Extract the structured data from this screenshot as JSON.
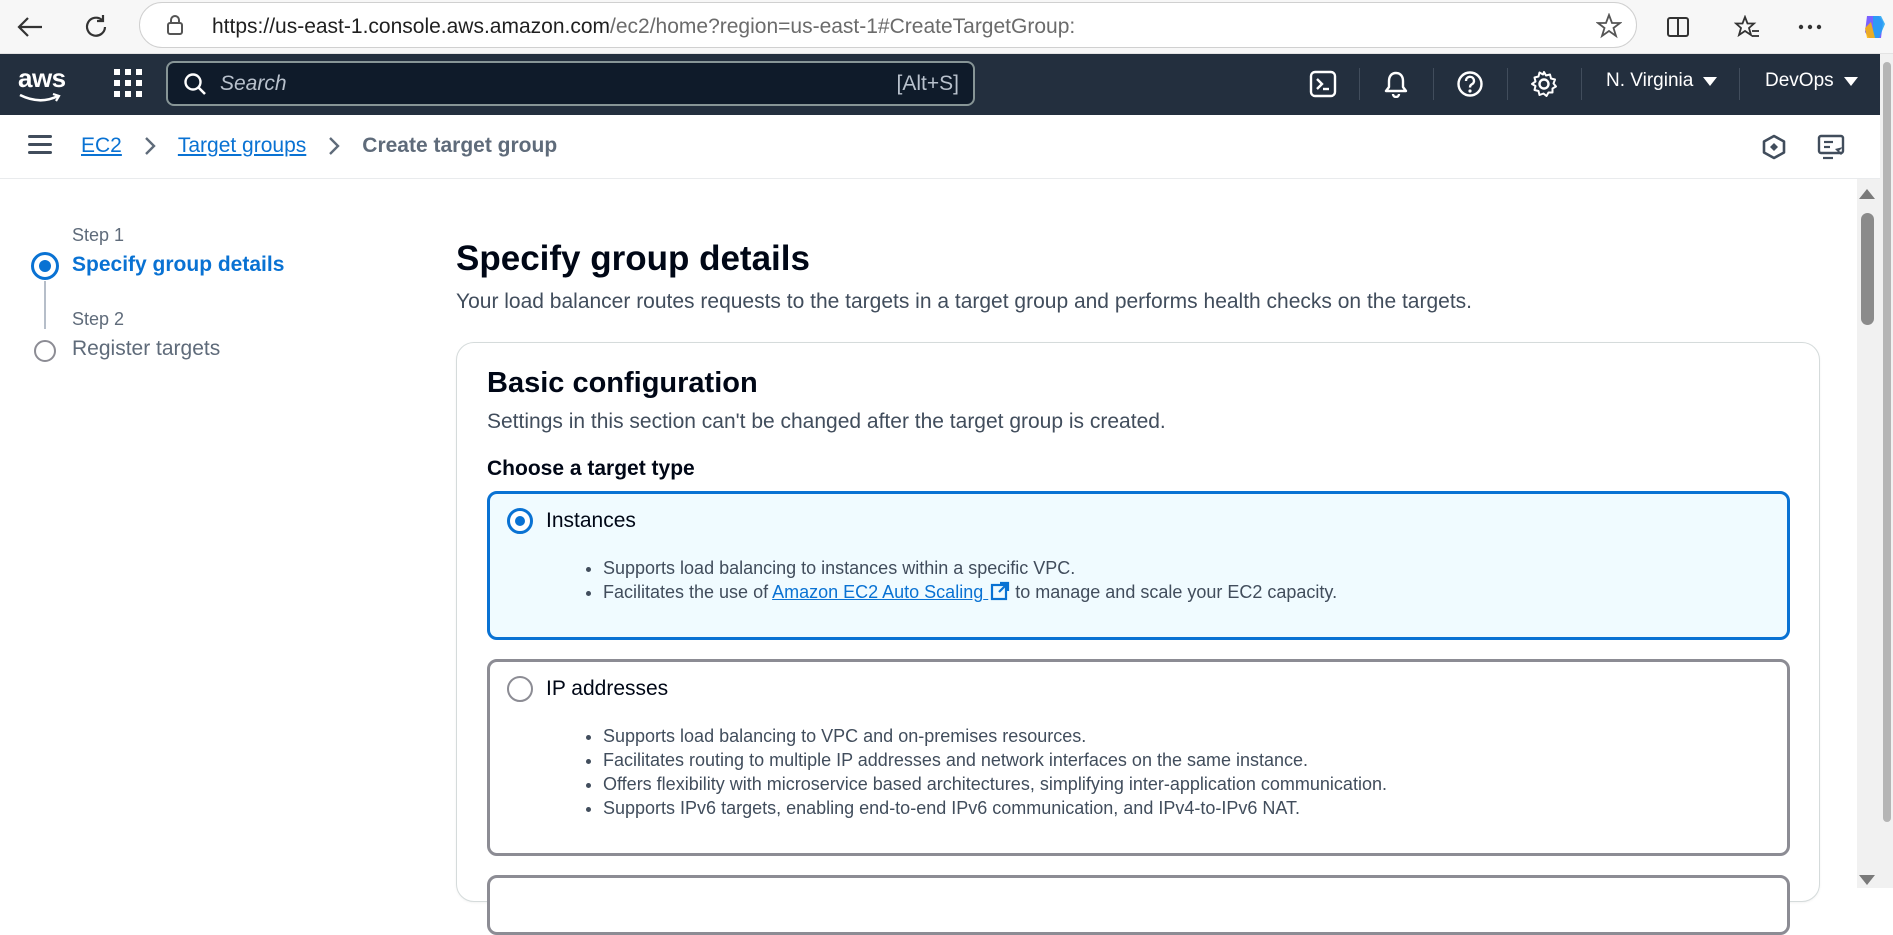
{
  "browser": {
    "url_host": "https://us-east-1.console.aws.amazon.com",
    "url_path": "/ec2/home?region=us-east-1#CreateTargetGroup:"
  },
  "topnav": {
    "logo_text": "aws",
    "search_placeholder": "Search",
    "search_shortcut": "[Alt+S]",
    "region": "N. Virginia",
    "account": "DevOps"
  },
  "breadcrumb": {
    "items": [
      {
        "label": "EC2"
      },
      {
        "label": "Target groups"
      },
      {
        "label": "Create target group"
      }
    ]
  },
  "wizard": {
    "steps": [
      {
        "meta": "Step 1",
        "label": "Specify group details"
      },
      {
        "meta": "Step 2",
        "label": "Register targets"
      }
    ]
  },
  "main": {
    "title": "Specify group details",
    "description": "Your load balancer routes requests to the targets in a target group and performs health checks on the targets."
  },
  "basic_config": {
    "title": "Basic configuration",
    "description": "Settings in this section can't be changed after the target group is created.",
    "target_type_label": "Choose a target type",
    "options": [
      {
        "label": "Instances",
        "selected": true,
        "bullets": [
          "Supports load balancing to instances within a specific VPC.",
          {
            "prefix": "Facilitates the use of ",
            "link": "Amazon EC2 Auto Scaling",
            "suffix": " to manage and scale your EC2 capacity."
          }
        ]
      },
      {
        "label": "IP addresses",
        "selected": false,
        "bullets": [
          "Supports load balancing to VPC and on-premises resources.",
          "Facilitates routing to multiple IP addresses and network interfaces on the same instance.",
          "Offers flexibility with microservice based architectures, simplifying inter-application communication.",
          "Supports IPv6 targets, enabling end-to-end IPv6 communication, and IPv4-to-IPv6 NAT."
        ]
      }
    ]
  },
  "colors": {
    "nav_bg": "#232f3e",
    "link": "#0972d3",
    "selected_tile_bg": "#f0fbff"
  }
}
